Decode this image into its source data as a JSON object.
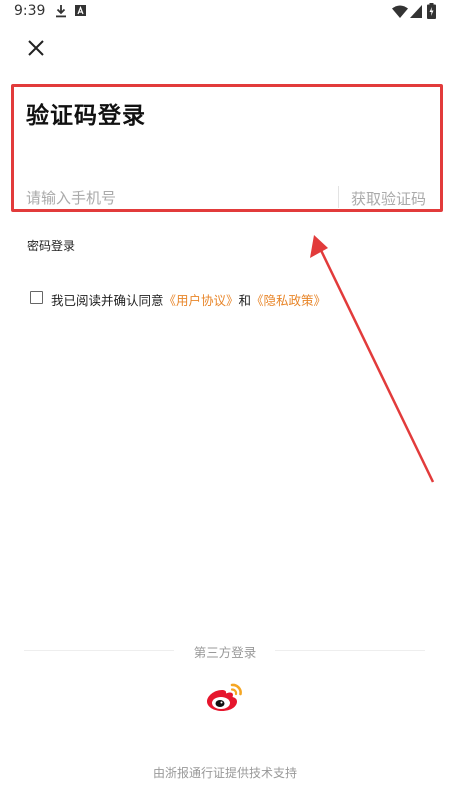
{
  "status_bar": {
    "time": "9:39",
    "icons": [
      "download-icon",
      "a-icon",
      "wifi-icon",
      "signal-icon",
      "battery-icon"
    ]
  },
  "login": {
    "title": "验证码登录",
    "phone_placeholder": "请输入手机号",
    "get_code_label": "获取验证码",
    "password_login_label": "密码登录",
    "agreement": {
      "prefix": "我已阅读并确认同意",
      "user_agreement": "《用户协议》",
      "connector": "和",
      "privacy_policy": "《隐私政策》"
    }
  },
  "third_party": {
    "label": "第三方登录",
    "providers": [
      "weibo-icon"
    ]
  },
  "footer": {
    "text": "由浙报通行证提供技术支持"
  },
  "colors": {
    "highlight_border": "#e23b3b",
    "arrow": "#e23b3b",
    "link": "#e8862a",
    "muted_text": "#999999",
    "placeholder": "#aaaaaa",
    "weibo_red": "#e6162d",
    "weibo_orange": "#f5a623"
  }
}
